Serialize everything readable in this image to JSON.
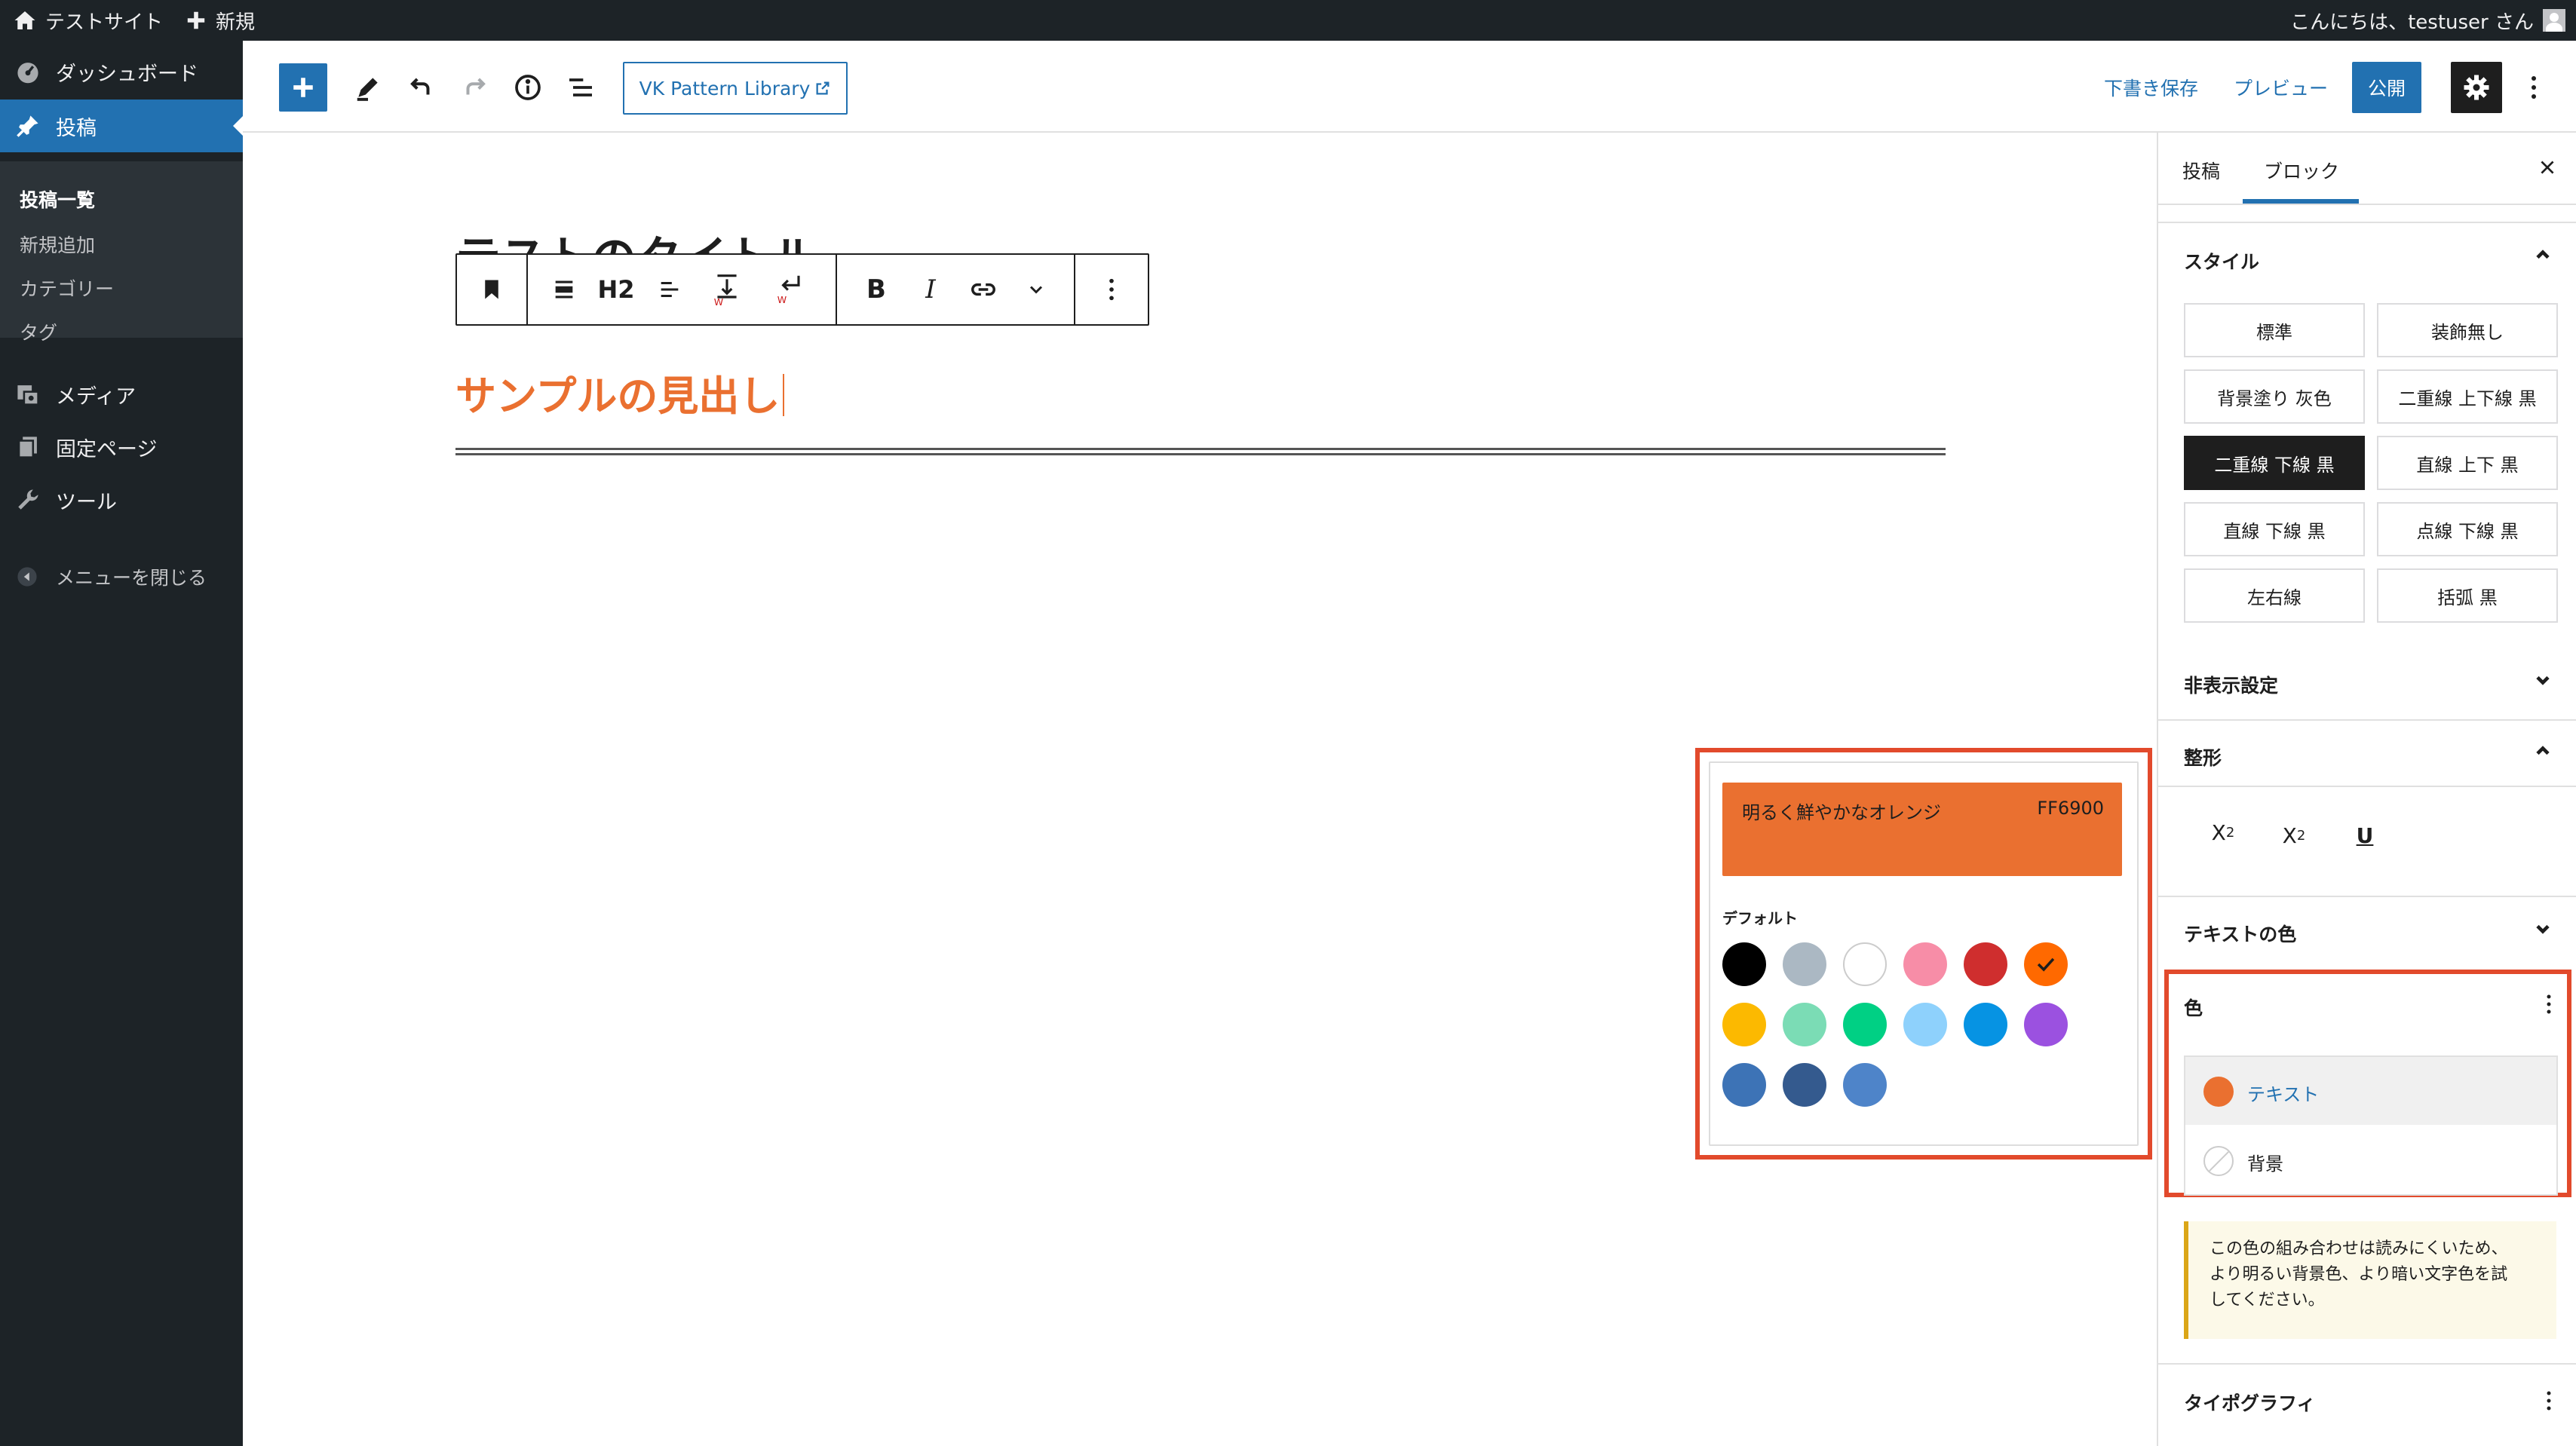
{
  "admin_bar": {
    "site_name": "テストサイト",
    "new_label": "新規",
    "greeting": "こんにちは、testuser さん"
  },
  "admin_menu": {
    "items": [
      {
        "label": "ダッシュボード",
        "icon": "dashboard-icon"
      },
      {
        "label": "投稿",
        "icon": "pin-icon"
      },
      {
        "label": "メディア",
        "icon": "media-icon"
      },
      {
        "label": "固定ページ",
        "icon": "pages-icon"
      },
      {
        "label": "ツール",
        "icon": "wrench-icon"
      }
    ],
    "submenu": [
      "投稿一覧",
      "新規追加",
      "カテゴリー",
      "タグ"
    ],
    "collapse_label": "メニューを閉じる"
  },
  "header": {
    "pattern_library_label": "VK Pattern Library",
    "save_draft_label": "下書き保存",
    "preview_label": "プレビュー",
    "publish_label": "公開"
  },
  "editor": {
    "post_title": "テストのタイトル",
    "heading_text": "サンプルの見出し",
    "toolbar_heading_level": "H2",
    "bold_label": "B",
    "italic_label": "I",
    "heading_color": "#ea7030"
  },
  "color_popover": {
    "color_name": "明るく鮮やかなオレンジ",
    "hex": "FF6900",
    "palette_label": "デフォルト",
    "swatches": [
      "#000000",
      "#abb8c3",
      "#ffffff",
      "#f78da7",
      "#cf2e2e",
      "#ff6900",
      "#fcb900",
      "#7bdcb5",
      "#00d084",
      "#8ed1fc",
      "#0693e3",
      "#9b51e0",
      "#3d73b6",
      "#345a8e",
      "#4e84c9"
    ],
    "selected_index": 5
  },
  "sidebar": {
    "tabs": [
      "投稿",
      "ブロック"
    ],
    "active_tab": "ブロック",
    "style_title": "スタイル",
    "style_buttons": [
      "標準",
      "装飾無し",
      "背景塗り 灰色",
      "二重線 上下線 黒",
      "二重線 下線 黒",
      "直線 上下 黒",
      "直線 下線 黒",
      "点線 下線 黒",
      "左右線",
      "括弧 黒"
    ],
    "active_style": "二重線 下線 黒",
    "hidden_settings_title": "非表示設定",
    "format_title": "整形",
    "format_buttons": [
      "X",
      "2",
      "X",
      "2",
      "U"
    ],
    "text_color_title": "テキストの色",
    "color_title": "色",
    "color_items": [
      "テキスト",
      "背景"
    ],
    "contrast_warning": [
      "この色の組み合わせは読みにくいため、",
      "より明るい背景色、より暗い文字色を試",
      "してください。"
    ],
    "typography_title": "タイポグラフィ"
  },
  "colors": {
    "admin_bg": "#1d2327",
    "accent": "#2271b1",
    "orange": "#ea7030",
    "highlight_frame": "#e24a2c"
  }
}
